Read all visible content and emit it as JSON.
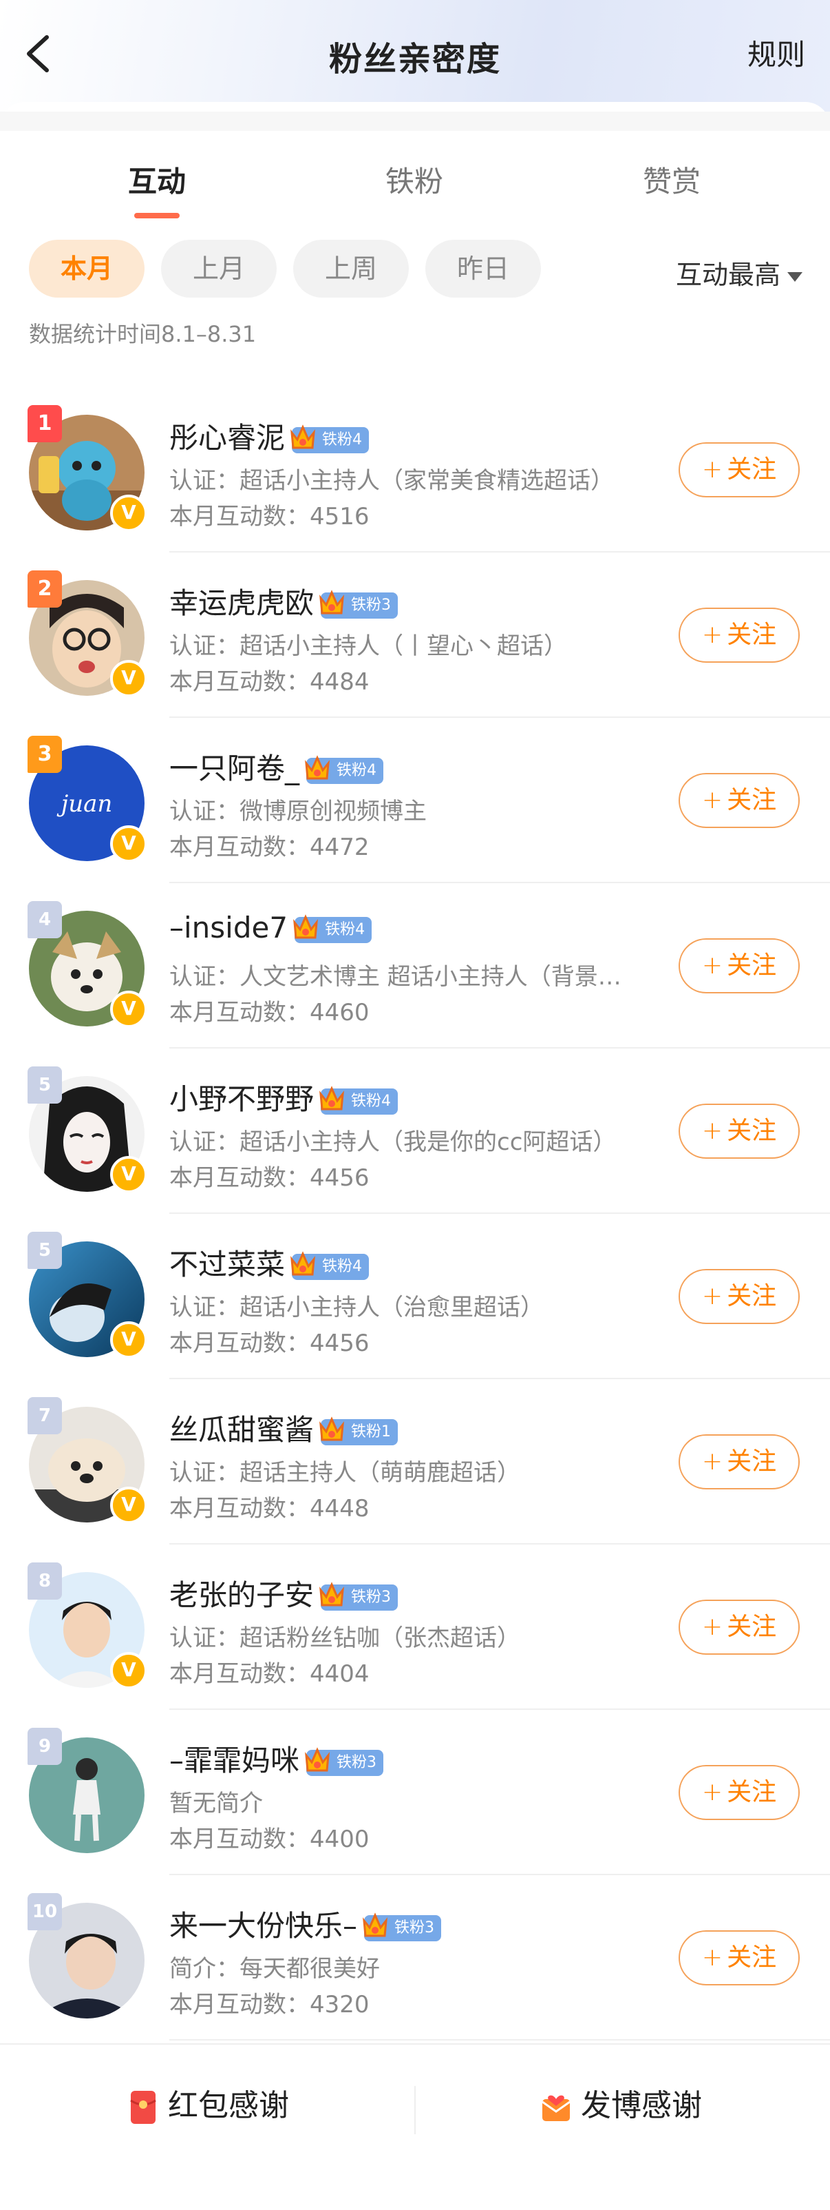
{
  "header": {
    "title": "粉丝亲密度",
    "rules_label": "规则"
  },
  "tabs": [
    {
      "label": "互动",
      "active": true
    },
    {
      "label": "铁粉",
      "active": false
    },
    {
      "label": "赞赏",
      "active": false
    }
  ],
  "filters": [
    {
      "label": "本月",
      "active": true
    },
    {
      "label": "上月",
      "active": false
    },
    {
      "label": "上周",
      "active": false
    },
    {
      "label": "昨日",
      "active": false
    }
  ],
  "sort_label": "互动最高",
  "period_text": "数据统计时间8.1–8.31",
  "follow_label": "关注",
  "colors": {
    "accent": "#ff8200",
    "rank1": "#ff4c4c",
    "rank2": "#ff7b3a",
    "rank3": "#ff9a1a",
    "fan_badge": "#76a8e8"
  },
  "fans": [
    {
      "rank": "1",
      "name": "彤心睿泥",
      "fan_level": "铁粉4",
      "cert": "认证：超话小主持人（家常美食精选超话）",
      "count": "本月互动数：4516"
    },
    {
      "rank": "2",
      "name": "幸运虎虎欧",
      "fan_level": "铁粉3",
      "cert": "认证：超话小主持人（丨望心丶超话）",
      "count": "本月互动数：4484"
    },
    {
      "rank": "3",
      "name": "一只阿卷_",
      "fan_level": "铁粉4",
      "cert": "认证：微博原创视频博主",
      "count": "本月互动数：4472",
      "avatar_text": "juan"
    },
    {
      "rank": "4",
      "name": "–inside7",
      "fan_level": "铁粉4",
      "cert": "认证：人文艺术博主 超话小主持人（背景…",
      "count": "本月互动数：4460"
    },
    {
      "rank": "5",
      "name": "小野不野野",
      "fan_level": "铁粉4",
      "cert": "认证：超话小主持人（我是你的cc阿超话）",
      "count": "本月互动数：4456"
    },
    {
      "rank": "5",
      "name": "不过菜菜",
      "fan_level": "铁粉4",
      "cert": "认证：超话小主持人（治愈里超话）",
      "count": "本月互动数：4456"
    },
    {
      "rank": "7",
      "name": "丝瓜甜蜜酱",
      "fan_level": "铁粉1",
      "cert": "认证：超话主持人（萌萌鹿超话）",
      "count": "本月互动数：4448"
    },
    {
      "rank": "8",
      "name": "老张的子安",
      "fan_level": "铁粉3",
      "cert": "认证：超话粉丝钻咖（张杰超话）",
      "count": "本月互动数：4404"
    },
    {
      "rank": "9",
      "name": "–霏霏妈咪",
      "fan_level": "铁粉3",
      "cert": "暂无简介",
      "count": "本月互动数：4400"
    },
    {
      "rank": "10",
      "name": "来一大份快乐–",
      "fan_level": "铁粉3",
      "cert": "简介：每天都很美好",
      "count": "本月互动数：4320"
    }
  ],
  "bottom_bar": {
    "red_packet_label": "红包感谢",
    "post_label": "发博感谢"
  }
}
